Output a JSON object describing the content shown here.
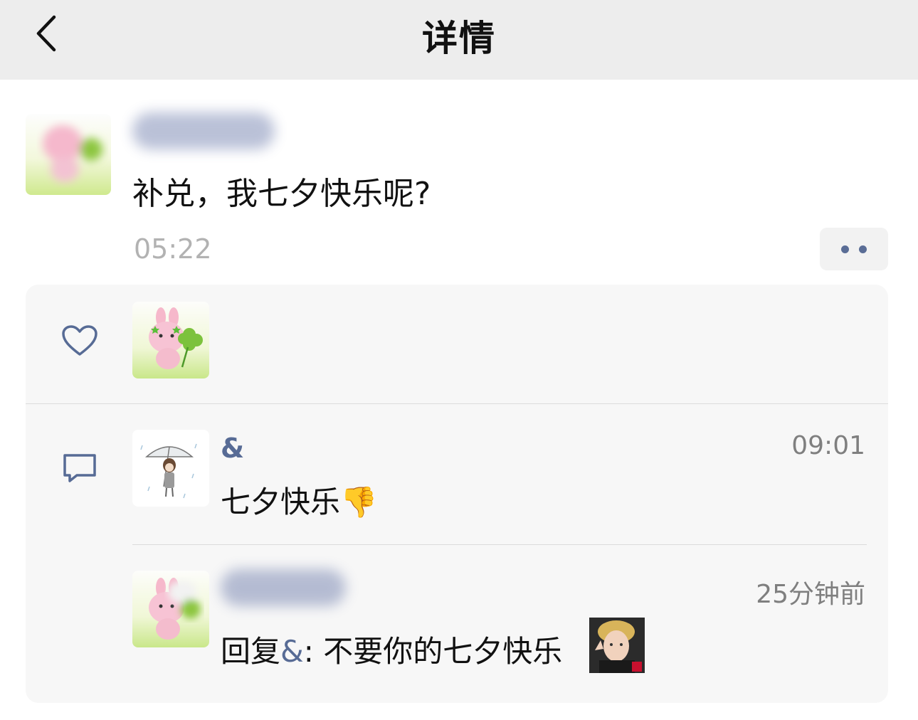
{
  "nav": {
    "title": "详情"
  },
  "post": {
    "text": "补兑，我七夕快乐呢?",
    "time": "05:22"
  },
  "comments": [
    {
      "name": "&",
      "time": "09:01",
      "text": "七夕快乐",
      "emoji": "👎"
    },
    {
      "time": "25分钟前",
      "reply_prefix": "回复",
      "reply_to": "&",
      "separator": ": ",
      "text": "不要你的七夕快乐"
    }
  ],
  "colors": {
    "nav_bg": "#ededed",
    "link": "#576b95",
    "panel_bg": "#f7f7f7"
  },
  "icons": [
    "back-chevron-icon",
    "heart-icon",
    "comment-icon",
    "more-dots-icon"
  ]
}
